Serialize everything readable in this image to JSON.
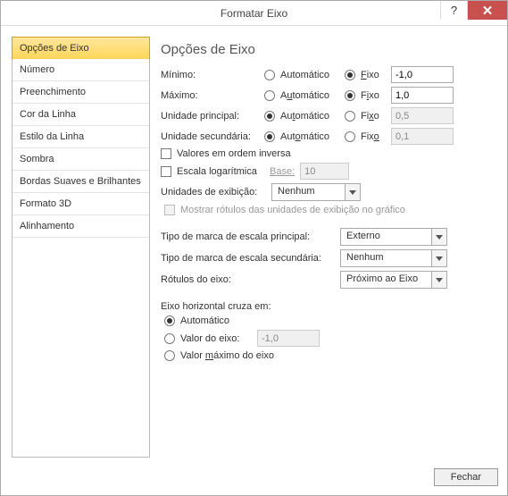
{
  "titlebar": {
    "title": "Formatar Eixo"
  },
  "sidebar": {
    "items": [
      "Opções de Eixo",
      "Número",
      "Preenchimento",
      "Cor da Linha",
      "Estilo da Linha",
      "Sombra",
      "Bordas Suaves e Brilhantes",
      "Formato 3D",
      "Alinhamento"
    ],
    "selected": 0
  },
  "main": {
    "title": "Opções de Eixo",
    "auto_label": "Automático",
    "fixed_label": "Fixo",
    "rows": {
      "min": {
        "label": "Mínimo:",
        "value": "-1,0",
        "mode": "fixed"
      },
      "max": {
        "label": "Máximo:",
        "value": "1,0",
        "mode": "fixed"
      },
      "maj": {
        "label": "Unidade principal:",
        "value": "0,5",
        "mode": "auto"
      },
      "minu": {
        "label": "Unidade secundária:",
        "value": "0,1",
        "mode": "auto"
      }
    },
    "reverse_label": "Valores em ordem inversa",
    "log_label": "Escala logarítmica",
    "log_base_label": "Base:",
    "log_base_value": "10",
    "units_label": "Unidades de exibição:",
    "units_value": "Nenhum",
    "units_show_label": "Mostrar rótulos das unidades de exibição no gráfico",
    "tick_major_label": "Tipo de marca de escala principal:",
    "tick_major_value": "Externo",
    "tick_minor_label": "Tipo de marca de escala secundária:",
    "tick_minor_value": "Nenhum",
    "axis_labels_label": "Rótulos do eixo:",
    "axis_labels_value": "Próximo ao Eixo",
    "crosses_title": "Eixo horizontal cruza em:",
    "crosses_auto": "Automático",
    "crosses_value_label": "Valor do eixo:",
    "crosses_value": "-1,0",
    "crosses_max_prefix": "Valor ",
    "crosses_max_u": "m",
    "crosses_max_suffix": "áximo do eixo"
  },
  "footer": {
    "close": "Fechar"
  }
}
